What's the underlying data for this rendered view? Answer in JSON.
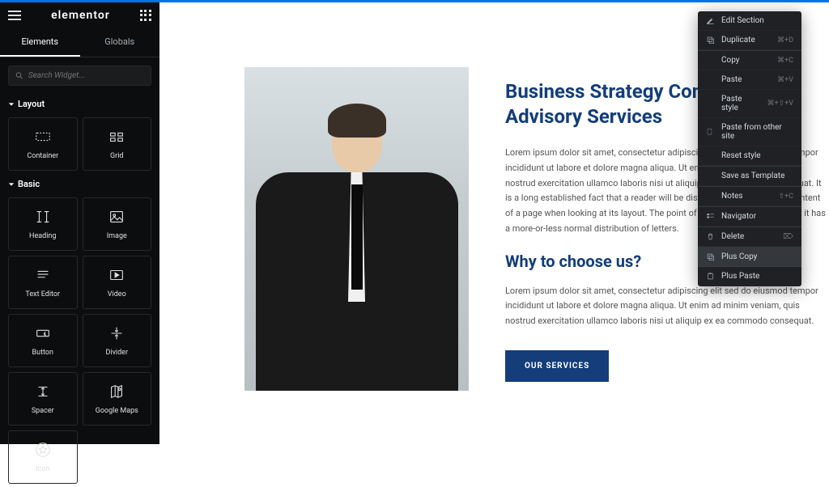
{
  "header": {
    "logo": "elementor"
  },
  "tabs": {
    "elements": "Elements",
    "globals": "Globals"
  },
  "search": {
    "placeholder": "Search Widget..."
  },
  "sections": {
    "layout": {
      "title": "Layout",
      "widgets": [
        {
          "name": "container",
          "label": "Container"
        },
        {
          "name": "grid",
          "label": "Grid"
        }
      ]
    },
    "basic": {
      "title": "Basic",
      "widgets": [
        {
          "name": "heading",
          "label": "Heading"
        },
        {
          "name": "image",
          "label": "Image"
        },
        {
          "name": "text-editor",
          "label": "Text Editor"
        },
        {
          "name": "video",
          "label": "Video"
        },
        {
          "name": "button",
          "label": "Button"
        },
        {
          "name": "divider",
          "label": "Divider"
        },
        {
          "name": "spacer",
          "label": "Spacer"
        },
        {
          "name": "google-maps",
          "label": "Google Maps"
        },
        {
          "name": "icon",
          "label": "Icon"
        }
      ]
    }
  },
  "page": {
    "heading": "Business Strategy Consulting and Advisory Services",
    "body1": "Lorem ipsum dolor sit amet, consectetur adipiscing elit sed do eiusmod tempor incididunt ut labore et dolore magna aliqua. Ut enim ad minim veniam, quis nostrud exercitation ullamco laboris nisi ut aliquip ex ea commodo consequat. It is a long established fact that a reader will be distracted by the readable content of a page when looking at its layout. The point of using Lorem Ipsum is that it has a more-or-less normal distribution of letters.",
    "subheading": "Why to choose us?",
    "body2": "Lorem ipsum dolor sit amet, consectetur adipiscing elit sed do eiusmod tempor incididunt ut labore et dolore magna aliqua. Ut enim ad minim veniam, quis nostrud exercitation ullamco laboris nisi ut aliquip ex ea commodo consequat.",
    "cta": "OUR SERVICES"
  },
  "context_menu": {
    "items": [
      {
        "icon": "edit",
        "label": "Edit Section",
        "shortcut": ""
      },
      {
        "icon": "duplicate",
        "label": "Duplicate",
        "shortcut": "⌘+D"
      },
      {
        "icon": "",
        "label": "Copy",
        "shortcut": "⌘+C"
      },
      {
        "icon": "",
        "label": "Paste",
        "shortcut": "⌘+V"
      },
      {
        "icon": "",
        "label": "Paste style",
        "shortcut": "⌘+⇧+V"
      },
      {
        "icon": "paste-site",
        "label": "Paste from other site",
        "shortcut": ""
      },
      {
        "icon": "",
        "label": "Reset style",
        "shortcut": ""
      },
      {
        "icon": "",
        "label": "Save as Template",
        "shortcut": ""
      },
      {
        "icon": "",
        "label": "Notes",
        "shortcut": "⇧+C"
      },
      {
        "icon": "navigator",
        "label": "Navigator",
        "shortcut": ""
      },
      {
        "icon": "delete",
        "label": "Delete",
        "shortcut": "⌦"
      },
      {
        "icon": "plus-copy",
        "label": "Plus Copy",
        "shortcut": ""
      },
      {
        "icon": "plus-paste",
        "label": "Plus Paste",
        "shortcut": ""
      }
    ]
  }
}
